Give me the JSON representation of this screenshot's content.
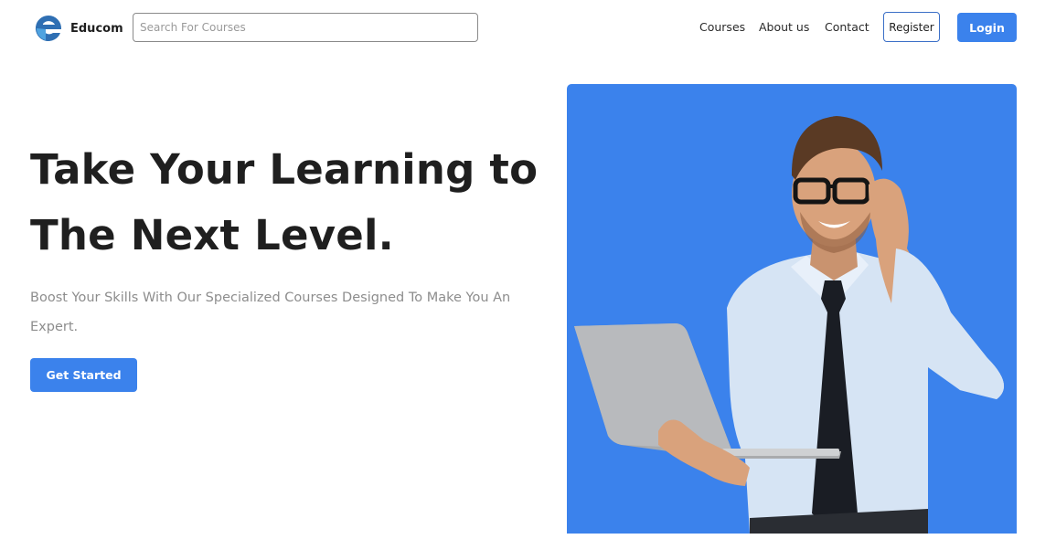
{
  "brand": {
    "name": "Educom",
    "logo_icon": "educom-e-logo-icon"
  },
  "search": {
    "placeholder": "Search For Courses",
    "value": ""
  },
  "nav": {
    "links": [
      {
        "label": "Courses"
      },
      {
        "label": "About us"
      },
      {
        "label": "Contact"
      }
    ],
    "register_label": "Register",
    "login_label": "Login"
  },
  "hero": {
    "title_line1": "Take Your Learning to",
    "title_line2": "The Next Level.",
    "subtitle": "Boost Your Skills With Our Specialized Courses Designed To Make You An Expert.",
    "cta_label": "Get Started",
    "image": "man-with-laptop-illustration"
  },
  "colors": {
    "accent": "#3b82ec",
    "register_border": "#3b6fc7",
    "title": "#1f1f1f",
    "subtitle": "#8d8d8d"
  }
}
